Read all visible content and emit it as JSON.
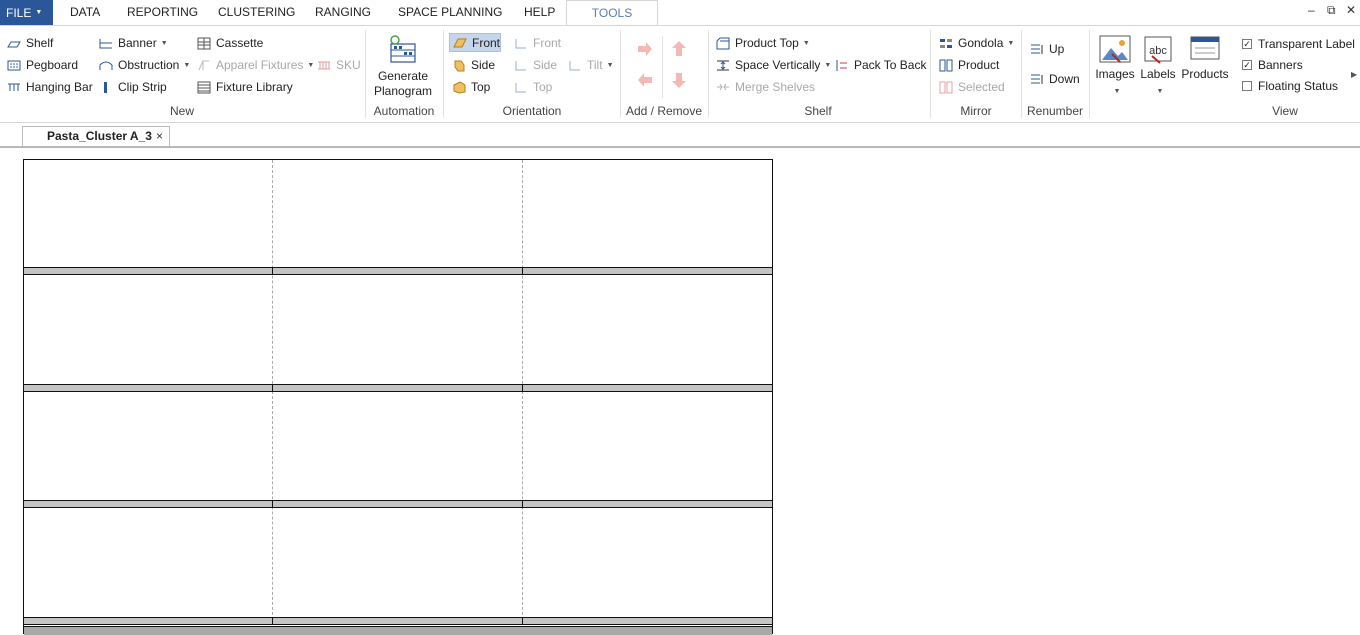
{
  "menu": {
    "file": "FILE",
    "items": [
      "DATA",
      "REPORTING",
      "CLUSTERING",
      "RANGING",
      "SPACE PLANNING",
      "HELP"
    ],
    "active_tab": "TOOLS"
  },
  "window_controls": {
    "minimize": "–",
    "restore": "⧉",
    "close": "✕"
  },
  "ribbon": {
    "new": {
      "label": "New",
      "shelf": "Shelf",
      "pegboard": "Pegboard",
      "hanging_bar": "Hanging Bar",
      "banner": "Banner",
      "obstruction": "Obstruction",
      "clip_strip": "Clip Strip",
      "cassette": "Cassette",
      "apparel_fixtures": "Apparel Fixtures",
      "fixture_library": "Fixture Library",
      "sku": "SKU"
    },
    "automation": {
      "label": "Automation",
      "generate": "Generate",
      "planogram": "Planogram"
    },
    "orientation": {
      "label": "Orientation",
      "front": "Front",
      "side": "Side",
      "top": "Top",
      "front2": "Front",
      "side2": "Side",
      "top2": "Top",
      "tilt": "Tilt"
    },
    "add_remove": {
      "label": "Add / Remove"
    },
    "shelf": {
      "label": "Shelf",
      "product_top": "Product Top",
      "space_vertically": "Space Vertically",
      "merge_shelves": "Merge Shelves",
      "pack_to_back": "Pack To Back"
    },
    "mirror": {
      "label": "Mirror",
      "gondola": "Gondola",
      "product": "Product",
      "selected": "Selected"
    },
    "renumber": {
      "label": "Renumber",
      "up": "Up",
      "down": "Down"
    },
    "view": {
      "label": "View",
      "images": "Images",
      "labels": "Labels",
      "products": "Products",
      "transparent_label": "Transparent Label",
      "banners": "Banners",
      "floating_status": "Floating Status",
      "transparent_label_checked": true,
      "banners_checked": true,
      "floating_status_checked": false
    }
  },
  "document_tab": {
    "title": "Pasta_Cluster A_3",
    "close": "×"
  },
  "colors": {
    "file_bg": "#2b579a",
    "tools_text": "#5a7fb0",
    "selected_bg": "#c5d5ea",
    "shelf_fill": "#c4c4c4"
  }
}
